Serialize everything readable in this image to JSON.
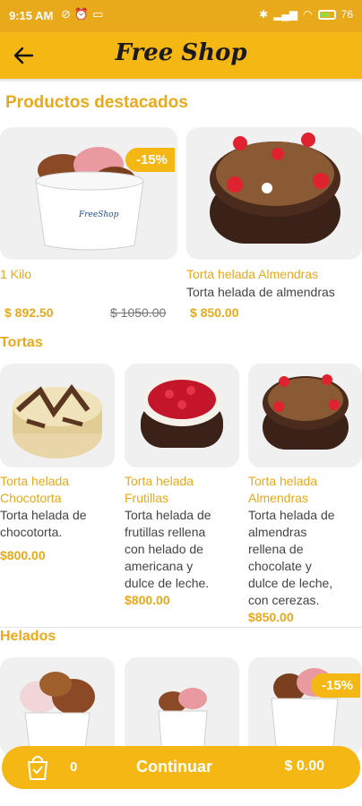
{
  "status_bar": {
    "time": "9:15 AM",
    "battery": "76"
  },
  "app_bar": {
    "title": "Free Shop"
  },
  "featured": {
    "title": "Productos destacados",
    "items": [
      {
        "name": "1 Kilo",
        "description": "",
        "price": "$ 892.50",
        "old_price": "$ 1050.00",
        "badge": "-15%"
      },
      {
        "name": "Torta helada Almendras",
        "description": "Torta helada de almendras",
        "price": "$ 850.00"
      }
    ]
  },
  "tortas": {
    "title": "Tortas",
    "items": [
      {
        "name_line1": "Torta helada",
        "name_line2": "Chocotorta",
        "desc_lines": [
          "Torta helada de",
          "chocotorta."
        ],
        "price": "$800.00"
      },
      {
        "name_line1": "Torta helada",
        "name_line2": "Frutillas",
        "desc_lines": [
          "Torta helada de",
          "frutillas rellena",
          "con helado de",
          "americana y",
          "dulce de leche."
        ],
        "price": "$800.00"
      },
      {
        "name_line1": "Torta helada",
        "name_line2": "Almendras",
        "desc_lines": [
          "Torta helada de",
          "almendras",
          "rellena de",
          "chocolate y",
          "dulce de leche,",
          "con cerezas."
        ],
        "price": "$850.00"
      }
    ]
  },
  "helados": {
    "title": "Helados",
    "badge": "-15%"
  },
  "cart": {
    "count": "0",
    "continue_label": "Continuar",
    "total": "$ 0.00"
  },
  "colors": {
    "accent": "#f5b714",
    "text_accent": "#e8a91a"
  }
}
